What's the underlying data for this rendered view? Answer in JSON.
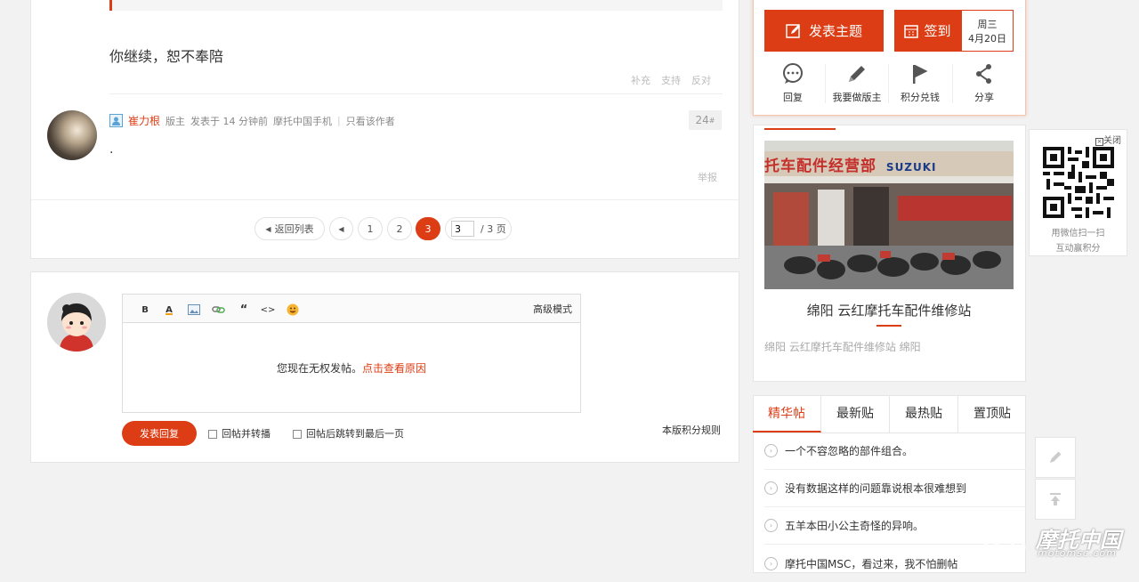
{
  "post": {
    "reply_text": "你继续，恕不奉陪",
    "actions": [
      "补充",
      "支持",
      "反对"
    ],
    "author": "崔力根",
    "role": "版主",
    "posted": "发表于 14 分钟前",
    "via": "摩托中国手机",
    "only_author": "只看该作者",
    "floor": "24",
    "floor_sup": "#",
    "body": ".",
    "report": "举报"
  },
  "pagination": {
    "back": "返回列表",
    "pages": [
      "1",
      "2",
      "3"
    ],
    "current": "3",
    "input_value": "3",
    "total": "/ 3 页"
  },
  "editor": {
    "tools": [
      "B",
      "A",
      "img",
      "link",
      "“",
      "<>",
      "emoji"
    ],
    "advanced": "高级模式",
    "notice": "您现在无权发帖。",
    "notice_link": "点击查看原因",
    "submit": "发表回复",
    "opt1": "回帖并转播",
    "opt2": "回帖后跳转到最后一页",
    "rules": "本版积分规则"
  },
  "sidebar": {
    "new_topic": "发表主题",
    "checkin": "签到",
    "weekday": "周三",
    "date": "4月20日",
    "icons": [
      {
        "label": "回复",
        "icon": "comment-icon"
      },
      {
        "label": "我要做版主",
        "icon": "pencil-icon"
      },
      {
        "label": "积分兑钱",
        "icon": "flag-icon"
      },
      {
        "label": "分享",
        "icon": "share-icon"
      }
    ],
    "shop_sign": "托车配件经营部",
    "shop_brand": "SUZUKI",
    "shop_title": "绵阳 云红摩托车配件维修站",
    "shop_sub": "绵阳 云红摩托车配件维修站 绵阳",
    "tabs": [
      "精华帖",
      "最新贴",
      "最热贴",
      "置顶贴"
    ],
    "list": [
      "一个不容忽略的部件组合。",
      "没有数据这样的问题靠说根本很难想到",
      "五羊本田小公主奇怪的异响。",
      "摩托中国MSC，看过来，我不怕删帖"
    ]
  },
  "qr": {
    "close": "关闭",
    "line1": "用微信扫一扫",
    "line2": "互动赢积分"
  },
  "watermark": {
    "text": "摩托中国",
    "url": "motomsc.com"
  },
  "colors": {
    "accent": "#dd3d14"
  }
}
